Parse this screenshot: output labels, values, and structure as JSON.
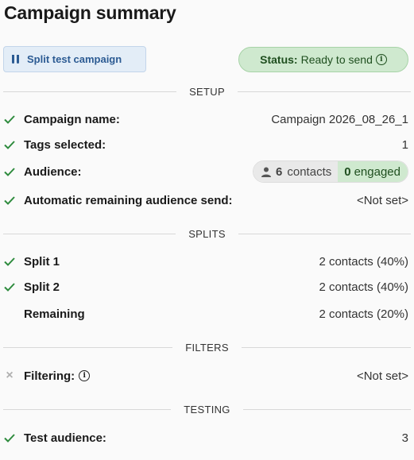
{
  "title": "Campaign summary",
  "split_badge": {
    "label": "Split test campaign",
    "icon": "flask-icon"
  },
  "status": {
    "label": "Status:",
    "value": "Ready to send",
    "bg": "#cfe9cf"
  },
  "sections": {
    "setup": "SETUP",
    "splits": "SPLITS",
    "filters": "FILTERS",
    "testing": "TESTING"
  },
  "setup": {
    "campaign_name": {
      "label": "Campaign name:",
      "value": "Campaign 2026_08_26_1"
    },
    "tags_selected": {
      "label": "Tags selected:",
      "value": "1"
    },
    "audience": {
      "label": "Audience:",
      "contacts_count": "6",
      "contacts_label": "contacts",
      "engaged_count": "0",
      "engaged_label": "engaged"
    },
    "auto_remaining": {
      "label": "Automatic remaining audience send:",
      "value": "<Not set>"
    }
  },
  "splits": [
    {
      "label": "Split 1",
      "value": "2 contacts (40%)"
    },
    {
      "label": "Split 2",
      "value": "2 contacts (40%)"
    },
    {
      "label": "Remaining",
      "value": "2 contacts (20%)"
    }
  ],
  "filters": {
    "label": "Filtering:",
    "value": "<Not set>"
  },
  "testing": {
    "label": "Test audience:",
    "value": "3"
  },
  "colors": {
    "check": "#2e8b3d",
    "accent": "#2c5b93"
  }
}
